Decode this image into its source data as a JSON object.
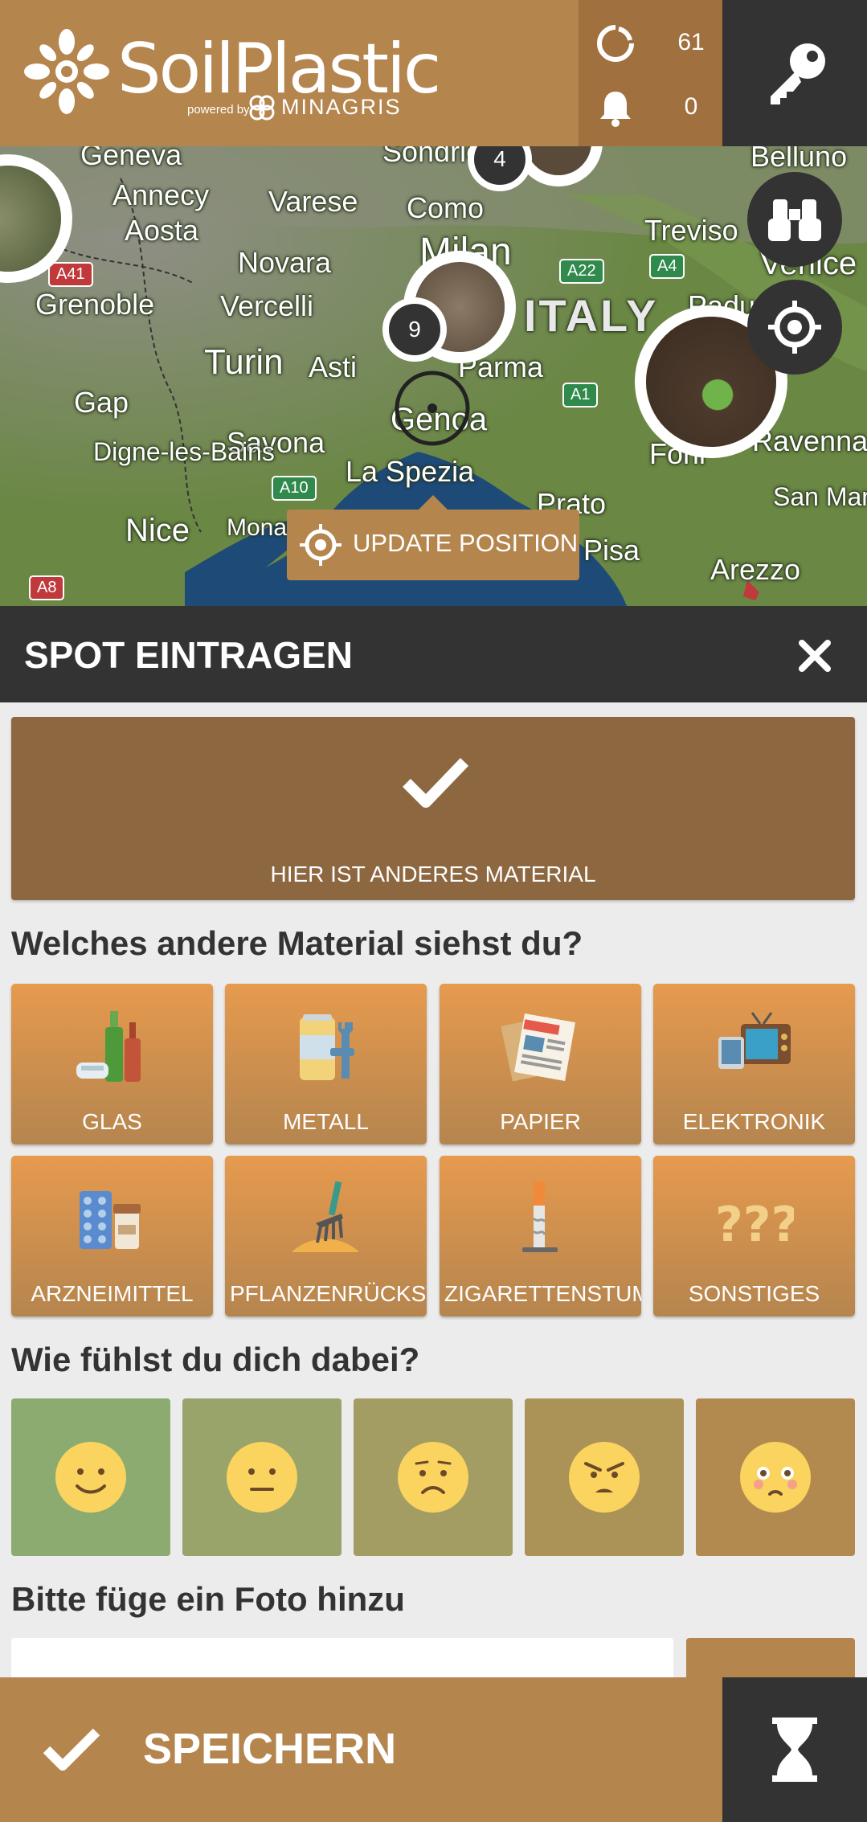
{
  "header": {
    "logo_title": "SoilPlastic",
    "logo_powered": "powered by",
    "logo_partner": "MINAGRIS",
    "stats": {
      "spots_count": "61",
      "notifications_count": "0"
    }
  },
  "map": {
    "cities": [
      "Geneva",
      "Annecy",
      "Aosta",
      "Grenoble",
      "Varese",
      "Como",
      "Sondrio",
      "Milan",
      "Novara",
      "Vercelli",
      "Turin",
      "Asti",
      "Parma",
      "Genoa",
      "Savona",
      "La Spezia",
      "Gap",
      "Digne-les-Bains",
      "Nice",
      "Monaco",
      "Belluno",
      "Treviso",
      "Venice",
      "Padua",
      "Forli",
      "Ravenna",
      "Prato",
      "Pisa",
      "San Marino",
      "Arezzo"
    ],
    "country": "ITALY",
    "roads": [
      "A41",
      "A22",
      "A4",
      "A1",
      "A10",
      "A8"
    ],
    "clusters": [
      "4",
      "9"
    ],
    "update_position_label": "UPDATE POSITION"
  },
  "form": {
    "title": "SPOT EINTRAGEN",
    "material_confirm_label": "HIER IST ANDERES MATERIAL",
    "material_question": "Welches andere Material siehst du?",
    "materials": [
      {
        "label": "GLAS",
        "icon": "glass-bottles-icon"
      },
      {
        "label": "METALL",
        "icon": "metal-can-wrench-icon"
      },
      {
        "label": "PAPIER",
        "icon": "newspaper-icon"
      },
      {
        "label": "ELEKTRONIK",
        "icon": "electronics-icon"
      },
      {
        "label": "ARZNEIMITTEL",
        "icon": "medicine-icon"
      },
      {
        "label": "PFLANZENRÜCKSTÄNDE",
        "icon": "plant-residue-icon"
      },
      {
        "label": "ZIGARETTENSTUMMEL",
        "icon": "cigarette-butt-icon"
      },
      {
        "label": "SONSTIGES",
        "icon": "question-marks-icon"
      }
    ],
    "mood_question": "Wie fühlst du dich dabei?",
    "moods": [
      {
        "name": "happy",
        "color": "#8cab70"
      },
      {
        "name": "neutral",
        "color": "#98a46a"
      },
      {
        "name": "concerned",
        "color": "#a39d63"
      },
      {
        "name": "angry",
        "color": "#ab9358"
      },
      {
        "name": "shocked",
        "color": "#b28a50"
      }
    ],
    "photo_question": "Bitte füge ein Foto hinzu"
  },
  "footer": {
    "save_label": "SPEICHERN"
  },
  "colors": {
    "brand": "#b5854e",
    "dark": "#333333",
    "confirm": "#8d6740",
    "tile_top": "#e69a4e"
  }
}
